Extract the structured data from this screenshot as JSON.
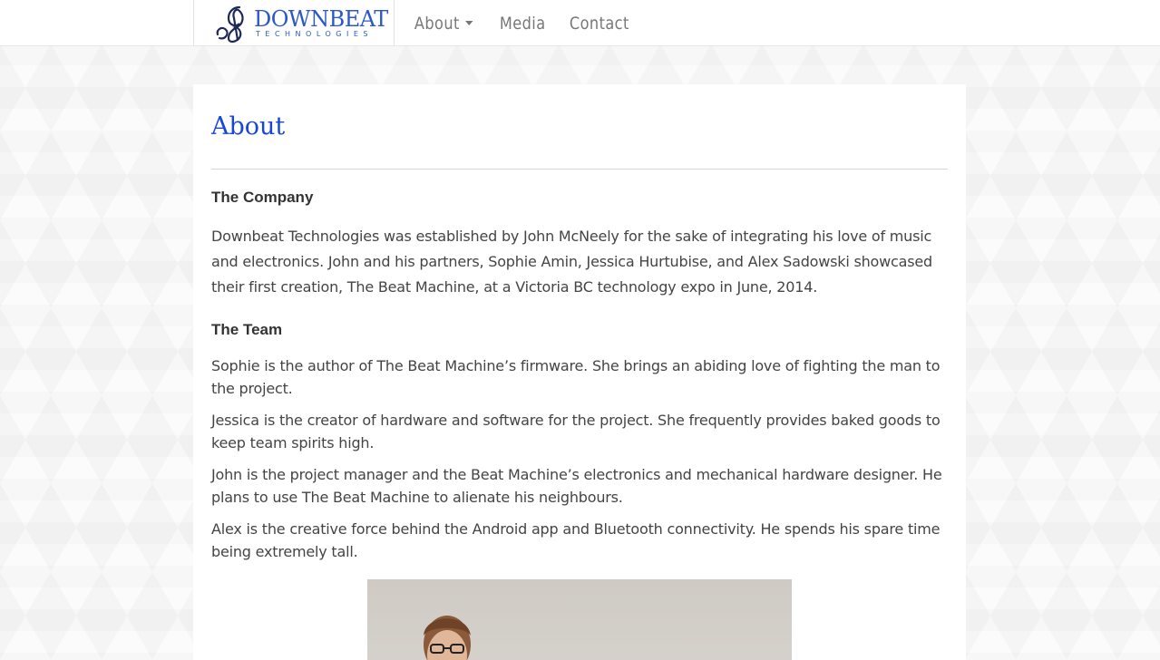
{
  "brand": {
    "name": "DOWNBEAT",
    "tagline": "TECHNOLOGIES",
    "color": "#2a58c8"
  },
  "nav": {
    "items": [
      {
        "label": "About",
        "has_dropdown": true
      },
      {
        "label": "Media",
        "has_dropdown": false
      },
      {
        "label": "Contact",
        "has_dropdown": false
      }
    ]
  },
  "main": {
    "title": "About",
    "title_color": "#1747d6",
    "company_heading": "The Company",
    "company_text": "Downbeat Technologies was established by John McNeely for the sake of integrating his love of music and electronics. John and his partners, Sophie Amin, Jessica Hurtubise, and Alex Sadowski showcased their first creation, The Beat Machine, at a Victoria BC technology expo in June, 2014.",
    "team_heading": "The Team",
    "team": [
      "Sophie is the author of The Beat Machine’s firmware. She brings an abiding love of fighting the man to the project.",
      "Jessica is the creator of hardware and software for the project. She frequently provides baked goods to keep team spirits high.",
      "John is the project manager and the Beat Machine’s electronics and mechanical hardware designer. He plans to use The Beat Machine to alienate his neighbours.",
      "Alex is the creative force behind the Android app and Bluetooth connectivity. He spends his spare time being extremely tall."
    ]
  }
}
